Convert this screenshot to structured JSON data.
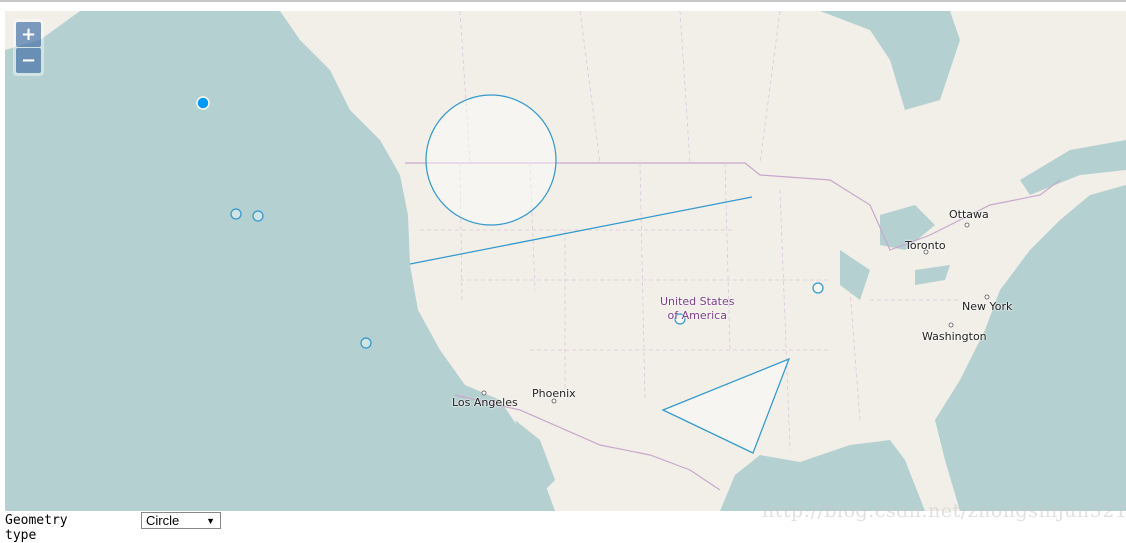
{
  "map": {
    "zoom_in_label": "+",
    "zoom_out_label": "−",
    "colors": {
      "water": "#b5d0d0",
      "land": "#f2efe9",
      "border": "#c9a7cd",
      "feature_stroke": "#3399cc",
      "point_fill": "#0099ff"
    },
    "labels": {
      "ottawa": "Ottawa",
      "toronto": "Toronto",
      "new_york": "New York",
      "washington": "Washington",
      "usa_line1": "United States",
      "usa_line2": "of America",
      "los_angeles": "Los Angeles",
      "phoenix": "Phoenix"
    },
    "features": [
      "point",
      "point",
      "point",
      "point",
      "point",
      "point",
      "circle",
      "line",
      "triangle"
    ]
  },
  "controls": {
    "geometry_type_label": "Geometry type",
    "geometry_type_value": "Circle"
  },
  "watermark": "http://blog.csdn.net/zhongshijun521"
}
